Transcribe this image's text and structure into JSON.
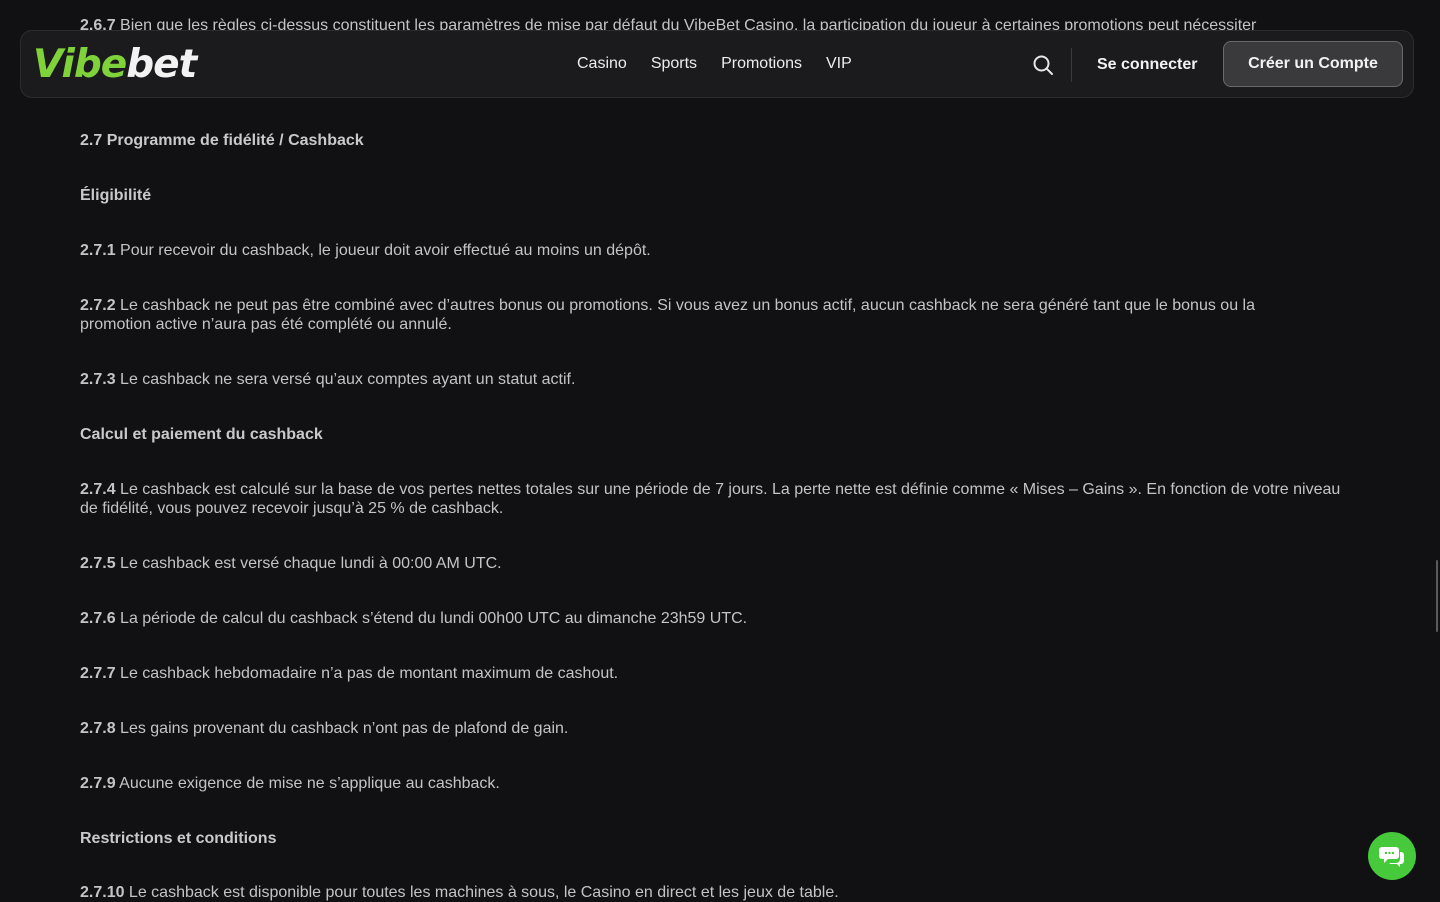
{
  "header": {
    "logo_part1": "Vibe",
    "logo_part2": "bet",
    "nav": [
      "Casino",
      "Sports",
      "Promotions",
      "VIP"
    ],
    "signin_label": "Se connecter",
    "register_label": "Créer un Compte"
  },
  "content": {
    "cut_top": {
      "num": "2.6.7",
      "text": " Bien que les règles ci-dessus constituent les paramètres de mise par défaut du VibeBet Casino, la participation du joueur à certaines promotions peut nécessiter"
    },
    "section_title": "2.7 Programme de fidélité / Cashback",
    "eligibility_title": "Éligibilité",
    "p271": {
      "num": "2.7.1",
      "text": " Pour recevoir du cashback, le joueur doit avoir effectué au moins un dépôt."
    },
    "p272": {
      "num": "2.7.2",
      "text": " Le cashback ne peut pas être combiné avec d’autres bonus ou promotions. Si vous avez un bonus actif, aucun cashback ne sera généré tant que le bonus ou la promotion active n’aura pas été complété ou annulé."
    },
    "p273": {
      "num": "2.7.3",
      "text": " Le cashback ne sera versé qu’aux comptes ayant un statut actif."
    },
    "calc_title": "Calcul et paiement du cashback",
    "p274": {
      "num": "2.7.4",
      "text": " Le cashback est calculé sur la base de vos pertes nettes totales sur une période de 7 jours. La perte nette est définie comme « Mises – Gains ». En fonction de votre niveau de fidélité, vous pouvez recevoir jusqu’à 25 % de cashback."
    },
    "p275": {
      "num": "2.7.5",
      "text": " Le cashback est versé chaque lundi à 00:00 AM UTC."
    },
    "p276": {
      "num": "2.7.6",
      "text": " La période de calcul du cashback s’étend du lundi 00h00 UTC au dimanche 23h59 UTC."
    },
    "p277": {
      "num": "2.7.7",
      "text": " Le cashback hebdomadaire n’a pas de montant maximum de cashout."
    },
    "p278": {
      "num": "2.7.8",
      "text": " Les gains provenant du cashback n’ont pas de plafond de gain."
    },
    "p279": {
      "num": "2.7.9",
      "text": " Aucune exigence de mise ne s’applique au cashback."
    },
    "restrictions_title": "Restrictions et conditions",
    "p2710": {
      "num": "2.7.10",
      "text": " Le cashback est disponible pour toutes les machines à sous, le Casino en direct et les jeux de table."
    }
  },
  "colors": {
    "background": "#111114",
    "accent_green": "#7fd23a",
    "chat_green": "#46c93a"
  },
  "icons": {
    "search": "search-icon",
    "chat": "chat-bubbles-icon"
  }
}
